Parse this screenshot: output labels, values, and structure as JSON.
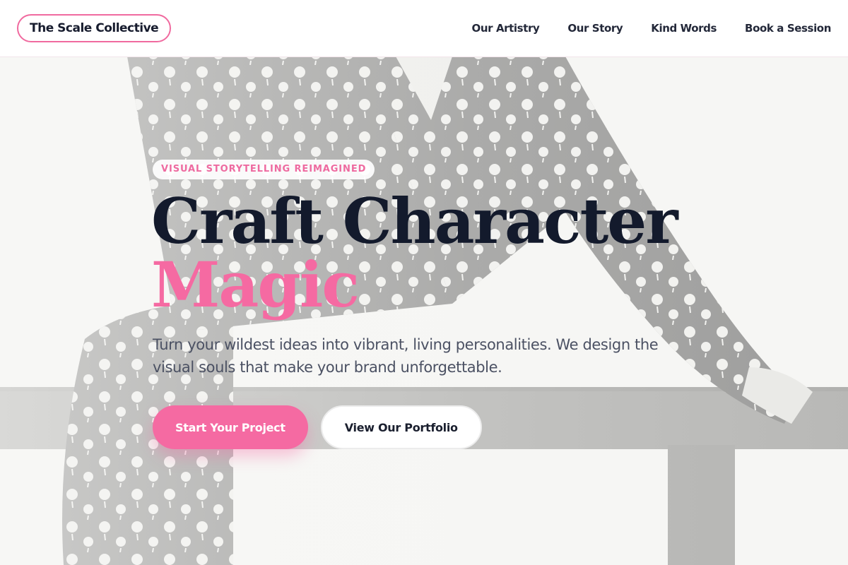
{
  "brand": {
    "name": "The Scale Collective"
  },
  "nav": {
    "items": [
      {
        "label": "Our Artistry"
      },
      {
        "label": "Our Story"
      },
      {
        "label": "Kind Words"
      },
      {
        "label": "Book a Session"
      }
    ]
  },
  "hero": {
    "eyebrow": "VISUAL STORYTELLING REIMAGINED",
    "headline_line1": "Craft Character",
    "headline_line2": "Magic",
    "subtext": "Turn your wildest ideas into vibrant, living personalities. We design the visual souls that make your brand unforgettable.",
    "primary_cta": "Start Your Project",
    "secondary_cta": "View Our Portfolio"
  },
  "colors": {
    "accent": "#f56aa2",
    "text_dark": "#131a2c",
    "text_muted": "#4b5163",
    "header_bg": "#ffffff"
  }
}
